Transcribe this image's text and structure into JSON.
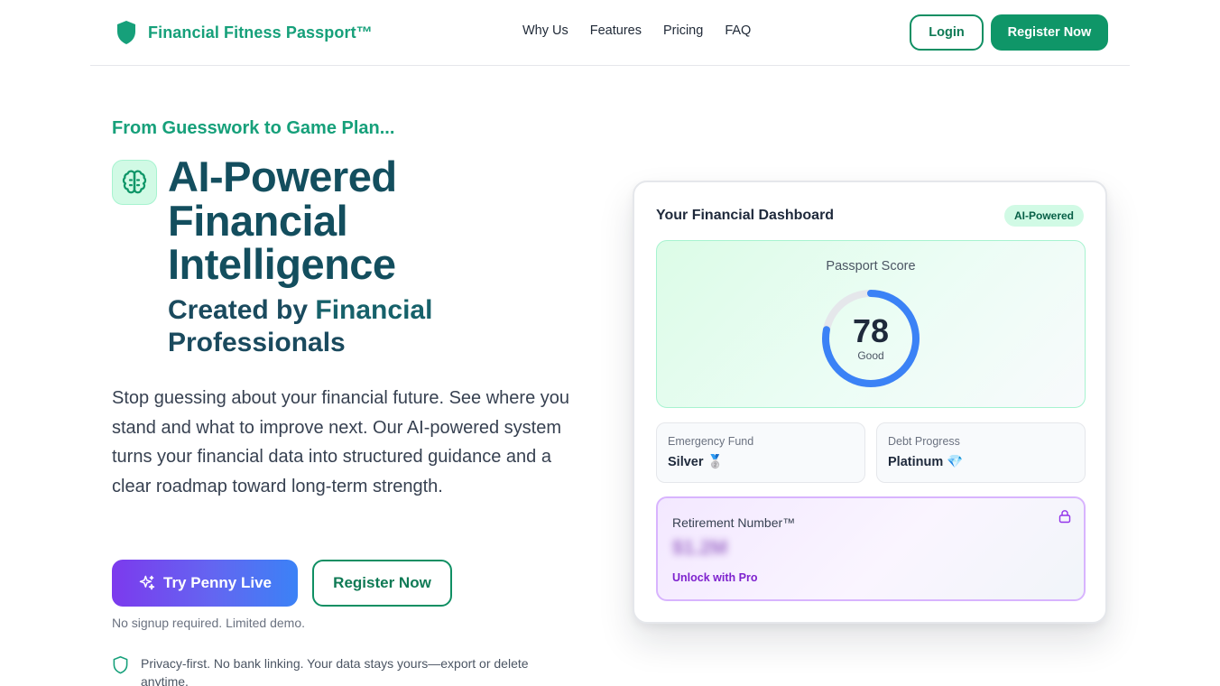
{
  "header": {
    "brand": "Financial Fitness Passport™",
    "nav": [
      "Why Us",
      "Features",
      "Pricing",
      "FAQ"
    ],
    "login_label": "Login",
    "register_label": "Register Now"
  },
  "hero": {
    "eyebrow": "From Guesswork to Game Plan...",
    "headline": "AI-Powered Financial Intelligence",
    "subhead_prefix": "Created by ",
    "subhead_highlight": "Financial",
    "subhead_suffix": " Professionals",
    "description": "Stop guessing about your financial future. See where you stand and what to improve next. Our AI-powered system turns your financial data into structured guidance and a clear roadmap toward long-term strength.",
    "primary_cta": "Try Penny Live",
    "secondary_cta": "Register Now",
    "note": "No signup required. Limited demo.",
    "privacy": "Privacy-first. No bank linking. Your data stays yours—export or delete anytime."
  },
  "dashboard": {
    "title": "Your Financial Dashboard",
    "badge": "AI-Powered",
    "score_label": "Passport Score",
    "score_value": "78",
    "score_max": 100,
    "score_word": "Good",
    "emergency_label": "Emergency Fund",
    "emergency_value": "Silver 🥈",
    "debt_label": "Debt Progress",
    "debt_value": "Platinum 💎",
    "retirement_label": "Retirement Number™",
    "retirement_value": "$1.2M",
    "retirement_unlock": "Unlock with Pro"
  },
  "colors": {
    "brand_green": "#16a07a",
    "ring_blue": "#3b82f6",
    "pro_purple": "#7e22ce"
  },
  "icons": [
    "shield-icon",
    "brain-icon",
    "sparkle-icon",
    "shield-check-icon",
    "lock-icon"
  ]
}
